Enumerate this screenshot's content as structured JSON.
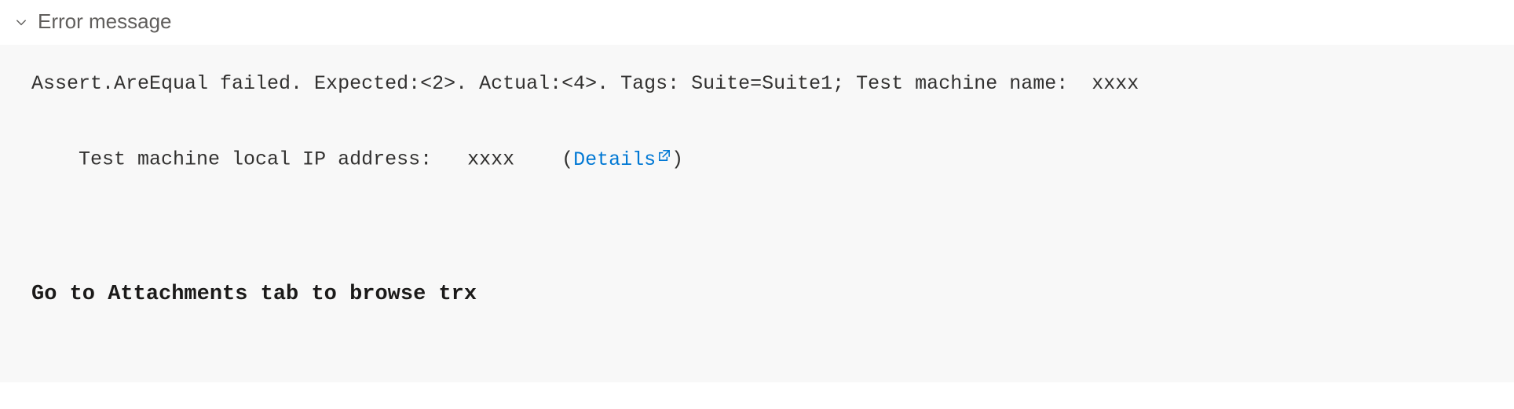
{
  "section": {
    "title": "Error message"
  },
  "error": {
    "line1": "Assert.AreEqual failed. Expected:<2>. Actual:<4>. Tags: Suite=Suite1; Test machine name:  xxxx",
    "line2_prefix": "Test machine local IP address:   xxxx    ",
    "details_label": "Details"
  },
  "hint": {
    "text": "Go to Attachments tab to browse trx"
  }
}
